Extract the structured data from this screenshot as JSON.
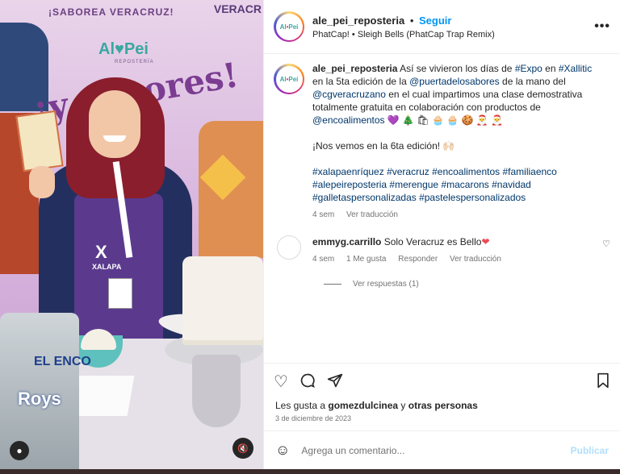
{
  "photo": {
    "banner_top": "¡SABOREA VERACRUZ!",
    "banner_right": "VERACR",
    "logo": "Al♥Pei",
    "logo_sub": "REPOSTERÍA",
    "slogan": "¡y sabores!",
    "apron_big": "X",
    "apron_small": "XALAPA",
    "bag_top": "EL ENCO",
    "bag_bottom": "Roys"
  },
  "header": {
    "username": "ale_pei_reposteria",
    "separator": "•",
    "follow_label": "Seguir",
    "audio": "PhatCap! • Sleigh Bells (PhatCap Trap Remix)",
    "avatar_text_a": "Al",
    "avatar_text_b": "•",
    "avatar_text_c": "Pei"
  },
  "caption": {
    "username": "ale_pei_reposteria",
    "t1": " Así se vivieron los días de ",
    "h_expo": "#Expo",
    "t2": " en ",
    "h_xallitic": "#Xallitic",
    "t3": " en la 5ta edición de la ",
    "m_puerta": "@puertadelosabores",
    "t4": " de la mano del ",
    "m_cg": "@cgveracruzano",
    "t5": " en el cual impartimos una clase demostrativa totalmente gratuita en colaboración con productos de ",
    "m_enco": "@encoalimentos",
    "emojis": " 💜 🎄 🛍 🧁 🧁 🍪 🎅 🎅",
    "line2": "¡Nos vemos en la 6ta edición! 🙌🏻",
    "hashtags": "#xalapaenríquez #veracruz #encoalimentos #familiaenco #alepeireposteria #merengue #macarons #navidad #galletaspersonalizadas #pastelespersonalizados",
    "time": "4 sem",
    "translate": "Ver traducción"
  },
  "comment1": {
    "username": "emmyg.carrillo",
    "text": " Solo Veracruz es Bello",
    "heart": "❤",
    "time": "4 sem",
    "likes": "1 Me gusta",
    "reply": "Responder",
    "translate": "Ver traducción",
    "replies": "Ver respuestas (1)"
  },
  "actions": {
    "like_icon": "heart-icon",
    "comment_icon": "comment-icon",
    "share_icon": "share-icon",
    "save_icon": "bookmark-icon"
  },
  "likes": {
    "prefix": "Les gusta a ",
    "user": "gomezdulcinea",
    "suffix": " y ",
    "others": "otras personas"
  },
  "date": "3 de diciembre de 2023",
  "add_comment": {
    "placeholder": "Agrega un comentario...",
    "publish": "Publicar"
  },
  "colors": {
    "link": "#00376b",
    "follow": "#0095f6",
    "muted": "#737373"
  }
}
